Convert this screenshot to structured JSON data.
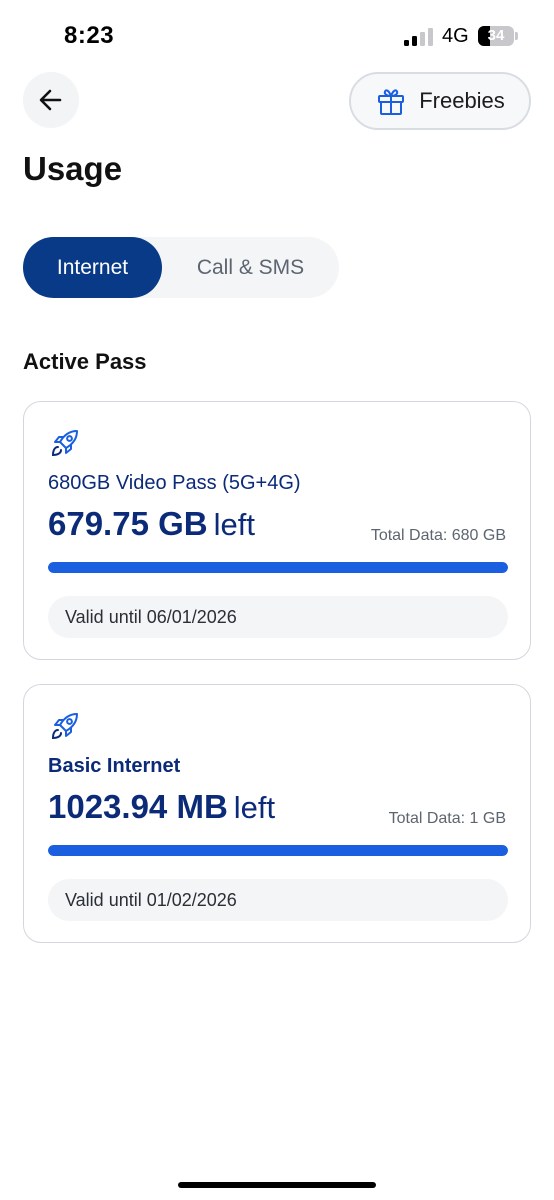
{
  "status_bar": {
    "time": "8:23",
    "network": "4G",
    "battery_level": "34",
    "battery_fraction": 0.34
  },
  "header": {
    "back_icon": "arrow-left-icon",
    "freebies_label": "Freebies",
    "freebies_icon": "gift-icon"
  },
  "page_title": "Usage",
  "tabs": [
    {
      "label": "Internet",
      "active": true
    },
    {
      "label": "Call & SMS",
      "active": false
    }
  ],
  "section_title": "Active Pass",
  "passes": [
    {
      "icon": "rocket-icon",
      "name": "680GB Video Pass (5G+4G)",
      "remaining": "679.75 GB",
      "remaining_suffix": "left",
      "total": "Total Data: 680 GB",
      "progress_fraction": 0.9996,
      "valid_until": "Valid until 06/01/2026"
    },
    {
      "icon": "rocket-icon",
      "name": "Basic Internet",
      "remaining": "1023.94 MB",
      "remaining_suffix": "left",
      "total": "Total Data: 1 GB",
      "progress_fraction": 0.9999,
      "valid_until": "Valid until 01/02/2026"
    }
  ],
  "colors": {
    "brand_navy": "#083a87",
    "text_navy": "#0b2a78",
    "progress_blue": "#1a5fe0"
  }
}
